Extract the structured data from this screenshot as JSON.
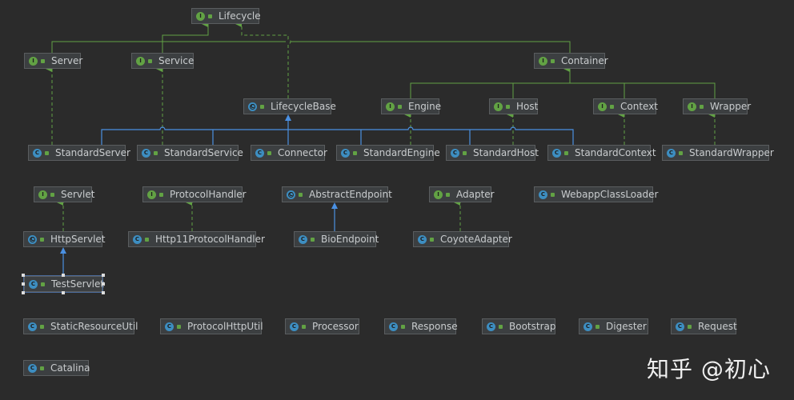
{
  "colors": {
    "background": "#2b2b2b",
    "interface": "#62a244",
    "class": "#3d8ec1",
    "implements_edge": "#62a244",
    "extends_edge": "#4a90e2"
  },
  "nodes": {
    "lifecycle": {
      "label": "Lifecycle",
      "kind": "interface"
    },
    "server": {
      "label": "Server",
      "kind": "interface"
    },
    "service": {
      "label": "Service",
      "kind": "interface"
    },
    "container": {
      "label": "Container",
      "kind": "interface"
    },
    "lifecyclebase": {
      "label": "LifecycleBase",
      "kind": "abstract-class"
    },
    "engine": {
      "label": "Engine",
      "kind": "interface"
    },
    "host": {
      "label": "Host",
      "kind": "interface"
    },
    "context": {
      "label": "Context",
      "kind": "interface"
    },
    "wrapper": {
      "label": "Wrapper",
      "kind": "interface"
    },
    "standardserver": {
      "label": "StandardServer",
      "kind": "class"
    },
    "standardservice": {
      "label": "StandardService",
      "kind": "class"
    },
    "connector": {
      "label": "Connector",
      "kind": "class"
    },
    "standardengine": {
      "label": "StandardEngine",
      "kind": "class"
    },
    "standardhost": {
      "label": "StandardHost",
      "kind": "class"
    },
    "standardcontext": {
      "label": "StandardContext",
      "kind": "class"
    },
    "standardwrapper": {
      "label": "StandardWrapper",
      "kind": "class"
    },
    "servlet": {
      "label": "Servlet",
      "kind": "interface"
    },
    "protocolhandler": {
      "label": "ProtocolHandler",
      "kind": "interface"
    },
    "abstractendpoint": {
      "label": "AbstractEndpoint",
      "kind": "abstract-class"
    },
    "adapter": {
      "label": "Adapter",
      "kind": "interface"
    },
    "webappclassloader": {
      "label": "WebappClassLoader",
      "kind": "class"
    },
    "httpservlet": {
      "label": "HttpServlet",
      "kind": "abstract-class"
    },
    "http11protocolhandler": {
      "label": "Http11ProtocolHandler",
      "kind": "class"
    },
    "bioendpoint": {
      "label": "BioEndpoint",
      "kind": "class"
    },
    "coyoteadapter": {
      "label": "CoyoteAdapter",
      "kind": "class"
    },
    "testservlet": {
      "label": "TestServlet",
      "kind": "class",
      "selected": true
    },
    "staticresourceutil": {
      "label": "StaticResourceUtil",
      "kind": "class"
    },
    "protocolhttputil": {
      "label": "ProtocolHttpUtil",
      "kind": "class"
    },
    "processor": {
      "label": "Processor",
      "kind": "class"
    },
    "response": {
      "label": "Response",
      "kind": "class"
    },
    "bootstrap": {
      "label": "Bootstrap",
      "kind": "class"
    },
    "digester": {
      "label": "Digester",
      "kind": "class"
    },
    "request": {
      "label": "Request",
      "kind": "class"
    },
    "catalina": {
      "label": "Catalina",
      "kind": "class"
    }
  },
  "watermark": "知乎 @初心"
}
